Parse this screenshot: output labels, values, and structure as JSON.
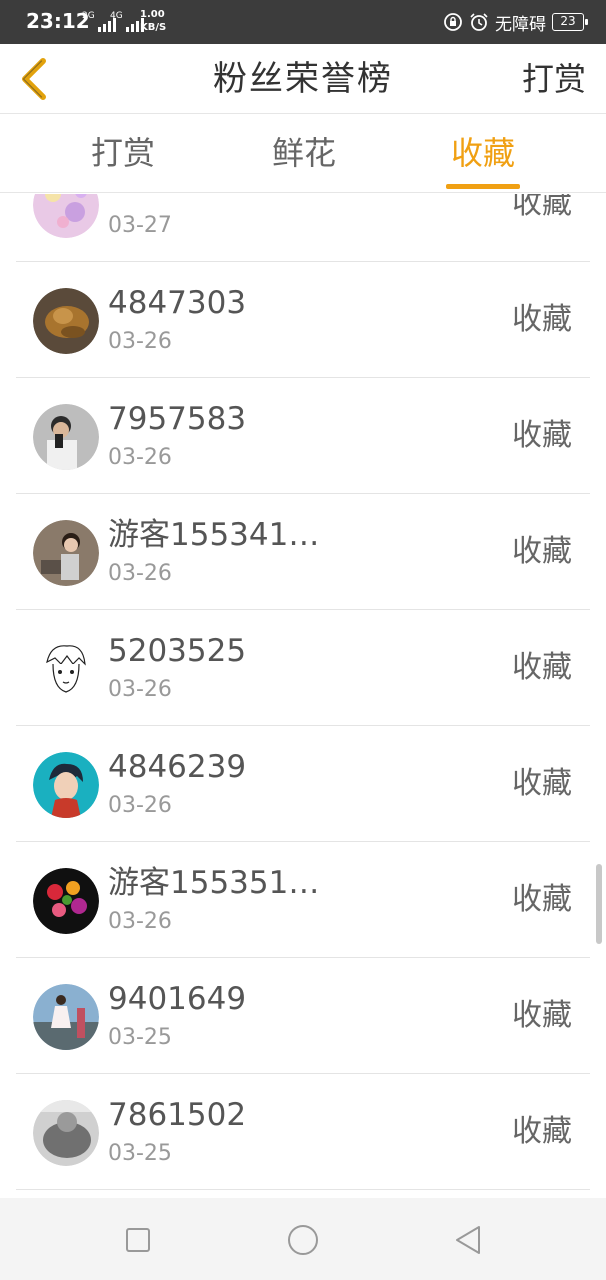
{
  "status_bar": {
    "time": "23:12",
    "signal1_net": "2G",
    "signal2_net": "4G",
    "net_speed_value": "1.00",
    "net_speed_unit": "KB/S",
    "accessibility": "无障碍",
    "battery": "23"
  },
  "header": {
    "title": "粉丝荣誉榜",
    "right_action": "打赏",
    "back_icon": "chevron-left-icon"
  },
  "tabs": [
    {
      "label": "打赏",
      "active": false
    },
    {
      "label": "鲜花",
      "active": false
    },
    {
      "label": "收藏",
      "active": true
    }
  ],
  "accent_color": "#f0a013",
  "list": [
    {
      "name": "",
      "date": "03-27",
      "action": "收藏",
      "avatar": "sparkle-avatar"
    },
    {
      "name": "4847303",
      "date": "03-26",
      "action": "收藏",
      "avatar": "bronze-statue-avatar"
    },
    {
      "name": "7957583",
      "date": "03-26",
      "action": "收藏",
      "avatar": "selfie-man-avatar"
    },
    {
      "name": "游客155341…",
      "date": "03-26",
      "action": "收藏",
      "avatar": "girl-photo-avatar"
    },
    {
      "name": "5203525",
      "date": "03-26",
      "action": "收藏",
      "avatar": "manga-boy-avatar"
    },
    {
      "name": "4846239",
      "date": "03-26",
      "action": "收藏",
      "avatar": "anime-boy-avatar"
    },
    {
      "name": "游客155351…",
      "date": "03-26",
      "action": "收藏",
      "avatar": "flowers-avatar"
    },
    {
      "name": "9401649",
      "date": "03-25",
      "action": "收藏",
      "avatar": "beach-girl-avatar"
    },
    {
      "name": "7861502",
      "date": "03-25",
      "action": "收藏",
      "avatar": "grey-photo-avatar"
    }
  ],
  "nav_bar": {
    "buttons": [
      "square-recents-icon",
      "circle-home-icon",
      "triangle-back-icon"
    ]
  }
}
